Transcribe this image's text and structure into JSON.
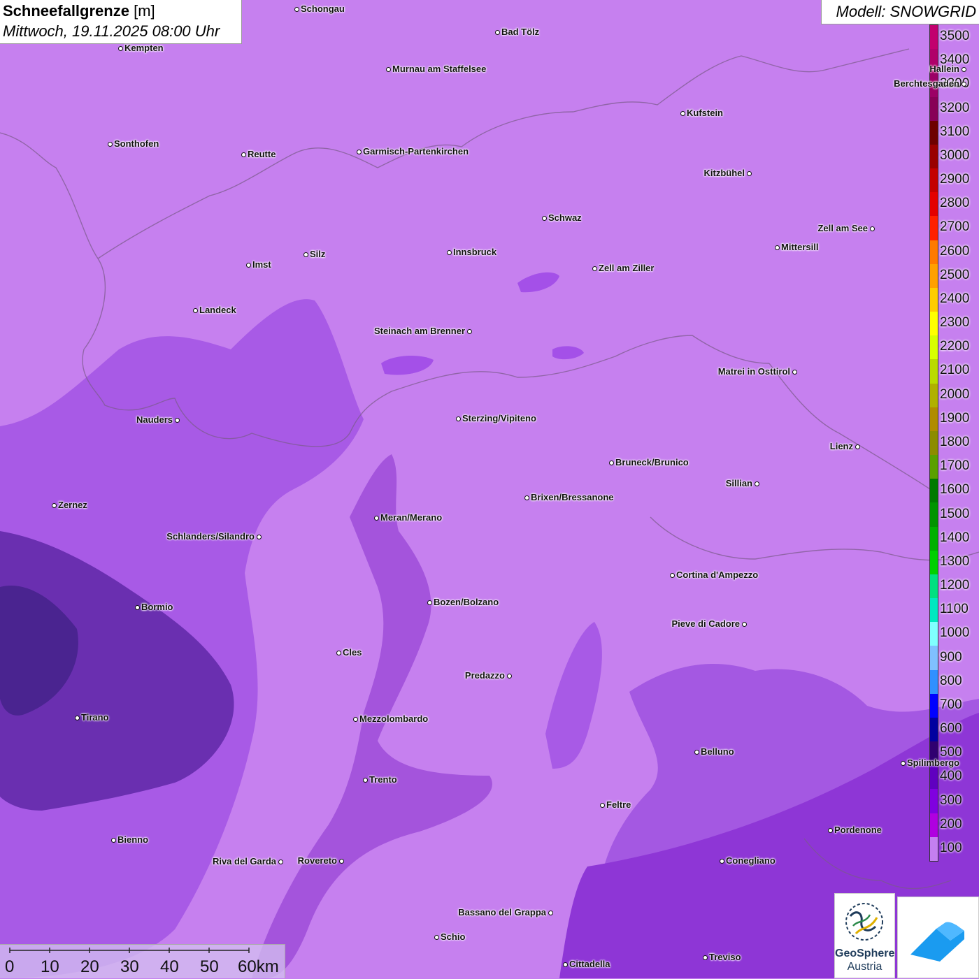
{
  "title": {
    "variable": "Schneefallgrenze",
    "unit": "[m]",
    "datetime": "Mittwoch, 19.11.2025 08:00 Uhr"
  },
  "model": "Modell: SNOWGRID",
  "legend": {
    "labels": [
      "3500",
      "3400",
      "3300",
      "3200",
      "3100",
      "3000",
      "2900",
      "2800",
      "2700",
      "2600",
      "2500",
      "2400",
      "2300",
      "2200",
      "2100",
      "2000",
      "1900",
      "1800",
      "1700",
      "1600",
      "1500",
      "1400",
      "1300",
      "1200",
      "1100",
      "1000",
      "900",
      "800",
      "700",
      "600",
      "500",
      "400",
      "300",
      "200",
      "100"
    ],
    "colors": [
      "#c2006e",
      "#b0006a",
      "#9c0066",
      "#880058",
      "#6e0000",
      "#9a0000",
      "#c40000",
      "#e40000",
      "#ff2000",
      "#ff7a00",
      "#ffa000",
      "#ffcc00",
      "#ffff00",
      "#d8ff00",
      "#bada00",
      "#b0b000",
      "#b08c00",
      "#8c8c00",
      "#5aa000",
      "#007a00",
      "#009400",
      "#00b000",
      "#00d000",
      "#00e080",
      "#00e8c0",
      "#80ffff",
      "#80c0ff",
      "#3090ff",
      "#0000ff",
      "#0000a0",
      "#300070",
      "#6000c0",
      "#8000e0",
      "#b000e0",
      "#c47ff0"
    ]
  },
  "cities": [
    {
      "name": "Schongau"
    },
    {
      "name": "Bad Tölz"
    },
    {
      "name": "Kempten"
    },
    {
      "name": "Murnau am Staffelsee"
    },
    {
      "name": "Berchtesgaden"
    },
    {
      "name": "Hallein"
    },
    {
      "name": "Kufstein"
    },
    {
      "name": "Sonthofen"
    },
    {
      "name": "Reutte"
    },
    {
      "name": "Garmisch-Partenkirchen"
    },
    {
      "name": "Kitzbühel"
    },
    {
      "name": "Schwaz"
    },
    {
      "name": "Zell am See"
    },
    {
      "name": "Mittersill"
    },
    {
      "name": "Innsbruck"
    },
    {
      "name": "Imst"
    },
    {
      "name": "Silz"
    },
    {
      "name": "Zell am Ziller"
    },
    {
      "name": "Landeck"
    },
    {
      "name": "Steinach am Brenner"
    },
    {
      "name": "Matrei in Osttirol"
    },
    {
      "name": "Nauders"
    },
    {
      "name": "Sterzing/Vipiteno"
    },
    {
      "name": "Lienz"
    },
    {
      "name": "Bruneck/Brunico"
    },
    {
      "name": "Sillian"
    },
    {
      "name": "Zernez"
    },
    {
      "name": "Brixen/Bressanone"
    },
    {
      "name": "Meran/Merano"
    },
    {
      "name": "Schlanders/Silandro"
    },
    {
      "name": "Cortina d'Ampezzo"
    },
    {
      "name": "Bozen/Bolzano"
    },
    {
      "name": "Bormio"
    },
    {
      "name": "Pieve di Cadore"
    },
    {
      "name": "Cles"
    },
    {
      "name": "Predazzo"
    },
    {
      "name": "Tirano"
    },
    {
      "name": "Mezzolombardo"
    },
    {
      "name": "Belluno"
    },
    {
      "name": "Spilimbergo"
    },
    {
      "name": "Trento"
    },
    {
      "name": "Feltre"
    },
    {
      "name": "Bienno"
    },
    {
      "name": "Pordenone"
    },
    {
      "name": "Riva del Garda"
    },
    {
      "name": "Rovereto"
    },
    {
      "name": "Conegliano"
    },
    {
      "name": "Bassano del Grappa"
    },
    {
      "name": "Schio"
    },
    {
      "name": "Treviso"
    },
    {
      "name": "Cittadella"
    }
  ],
  "scale": {
    "labels": [
      "0",
      "10",
      "20",
      "30",
      "40",
      "50",
      "60km"
    ]
  },
  "logos": {
    "geosphere_line1": "GeoSphere",
    "geosphere_line2": "Austria"
  }
}
